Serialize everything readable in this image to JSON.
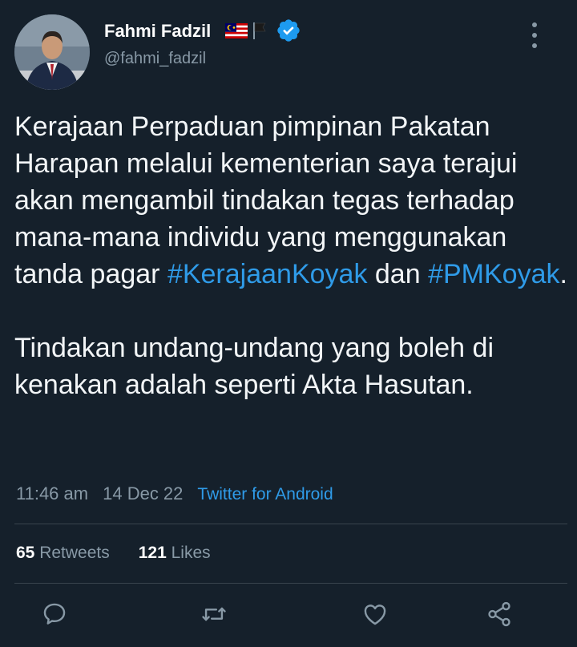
{
  "author": {
    "name": "Fahmi Fadzil",
    "handle": "@fahmi_fadzil",
    "verified": true
  },
  "tweet": {
    "paragraph1_part1": "Kerajaan Perpaduan pimpinan Pakatan Harapan melalui kementerian saya terajui akan mengambil tindakan tegas terhadap mana-mana individu yang menggunakan tanda pagar ",
    "hashtag1": "#KerajaanKoyak",
    "connector": " dan ",
    "hashtag2": "#PMKoyak",
    "end_punct": ".",
    "paragraph2": "Tindakan undang-undang yang boleh di kenakan adalah seperti Akta Hasutan."
  },
  "meta": {
    "time": "11:46 am",
    "date": "14 Dec 22",
    "source": "Twitter for Android"
  },
  "stats": {
    "retweets_count": "65",
    "retweets_label": " Retweets",
    "likes_count": "121",
    "likes_label": " Likes"
  },
  "icons": {
    "reply": "comment-icon",
    "retweet": "retweet-icon",
    "like": "heart-icon",
    "share": "share-icon",
    "more": "more-vertical-icon",
    "verified": "verified-badge-icon"
  },
  "colors": {
    "background": "#15202b",
    "text": "#f2f5f7",
    "secondary": "#8899a6",
    "link": "#2f9be8",
    "verified": "#1d9bf0",
    "divider": "#38444d"
  }
}
